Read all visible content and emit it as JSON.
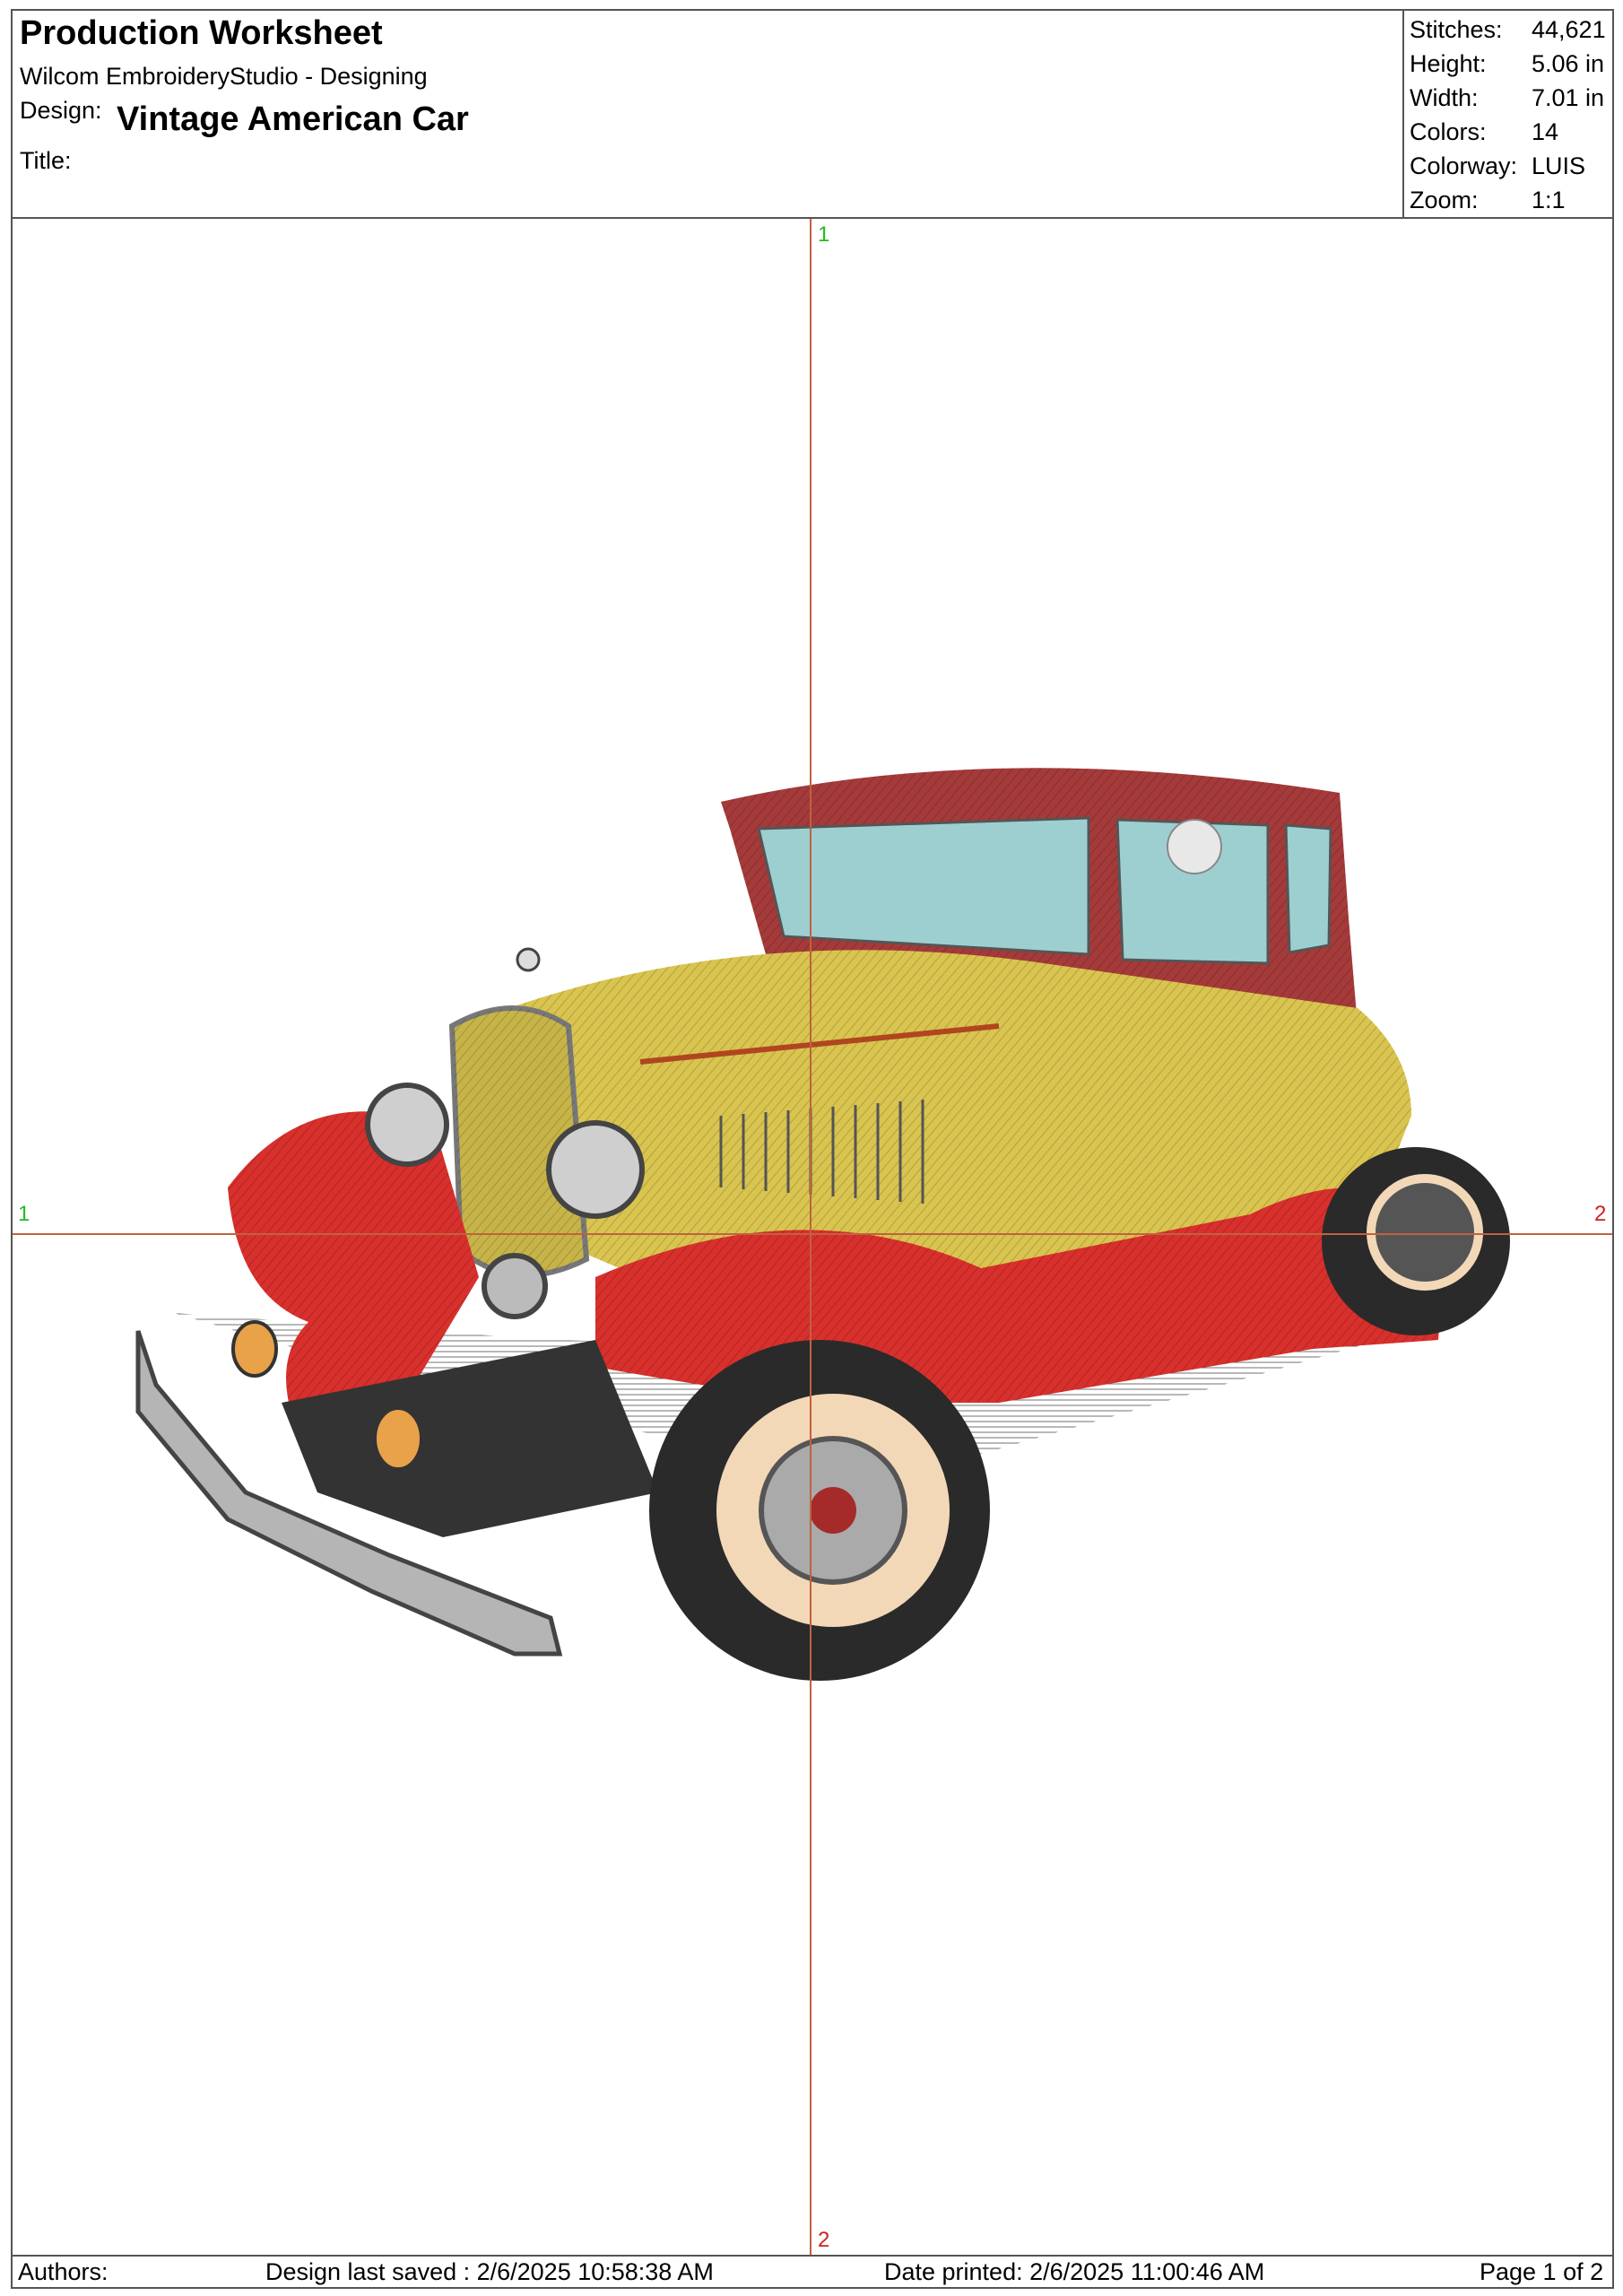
{
  "header": {
    "title": "Production Worksheet",
    "software": "Wilcom EmbroideryStudio - Designing",
    "design_label": "Design:",
    "design_name": "Vintage American Car",
    "title_label": "Title:"
  },
  "stats": [
    {
      "label": "Stitches:",
      "value": "44,621"
    },
    {
      "label": "Height:",
      "value": "5.06 in"
    },
    {
      "label": "Width:",
      "value": "7.01 in"
    },
    {
      "label": "Colors:",
      "value": "14"
    },
    {
      "label": "Colorway:",
      "value": "LUIS"
    },
    {
      "label": "Zoom:",
      "value": "1:1"
    }
  ],
  "guides": {
    "top": "1",
    "bottom": "2",
    "left": "1",
    "right": "2",
    "color": "#c0623f",
    "top_color": "#22bb22",
    "bottom_color": "#cc2222"
  },
  "footer": {
    "authors": "Authors:",
    "saved": "Design last saved : 2/6/2025 10:58:38 AM",
    "printed": "Date printed: 2/6/2025 11:00:46 AM",
    "page": "Page 1 of 2"
  },
  "colors": {
    "roof": "#a53a3a",
    "body": "#d9c44f",
    "fender": "#d8302c",
    "glass": "#9ecfd0",
    "tire": "#2a2a2a",
    "whitewall": "#f3d8b8",
    "chrome": "#9a9a9a"
  },
  "artwork": {
    "icon": "vintage-car-embroidery"
  }
}
